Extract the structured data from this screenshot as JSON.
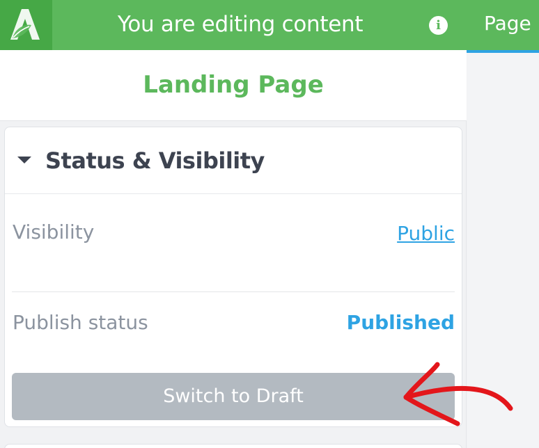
{
  "header": {
    "title": "You are editing content",
    "info_icon": "info-icon",
    "accent_color": "#5cb85c"
  },
  "tab": {
    "label": "Page",
    "active_underline_color": "#2ea3e3"
  },
  "document": {
    "title": "Landing Page"
  },
  "status_section": {
    "title": "Status & Visibility",
    "expanded": true,
    "visibility_label": "Visibility",
    "visibility_value": "Public",
    "publish_status_label": "Publish status",
    "publish_status_value": "Published",
    "switch_button_label": "Switch to Draft"
  },
  "annotation": {
    "arrow_color": "#e3161b",
    "icon": "hand-drawn-arrow"
  }
}
